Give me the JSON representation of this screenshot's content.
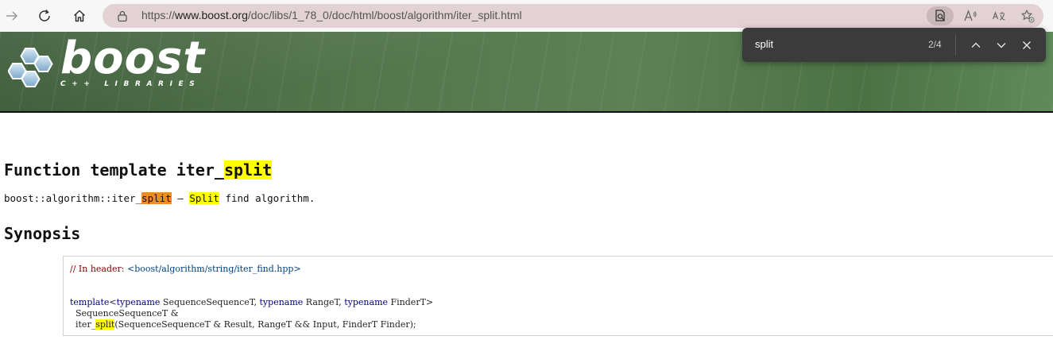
{
  "browser": {
    "url_scheme": "https://",
    "url_host": "www.boost.org",
    "url_path": "/doc/libs/1_78_0/doc/html/boost/algorithm/iter_split.html"
  },
  "banner": {
    "logo_word": "boost",
    "logo_subtitle": "C++ LIBRARIES"
  },
  "find": {
    "query": "split",
    "count": "2/4"
  },
  "doc": {
    "title_prefix": "Function template iter_",
    "title_match": "split",
    "purpose_prefix": "boost::algorithm::iter_",
    "purpose_match1": "split",
    "purpose_dash": " — ",
    "purpose_match2": "Split",
    "purpose_suffix": " find algorithm.",
    "synopsis_heading": "Synopsis",
    "code_comment": "// In header: ",
    "code_header": "<boost/algorithm/string/iter_find.hpp>",
    "code_template": "template",
    "code_lt": "<",
    "code_typename": "typename",
    "code_p1": " SequenceSequenceT, ",
    "code_p2": " RangeT, ",
    "code_p3": " FinderT>",
    "code_ret1": "  SequenceSequenceT &",
    "code_fn_prefix": "  iter_",
    "code_fn_match": "split",
    "code_fn_suffix": "(SequenceSequenceT & Result, RangeT && Input, FinderT Finder);"
  }
}
